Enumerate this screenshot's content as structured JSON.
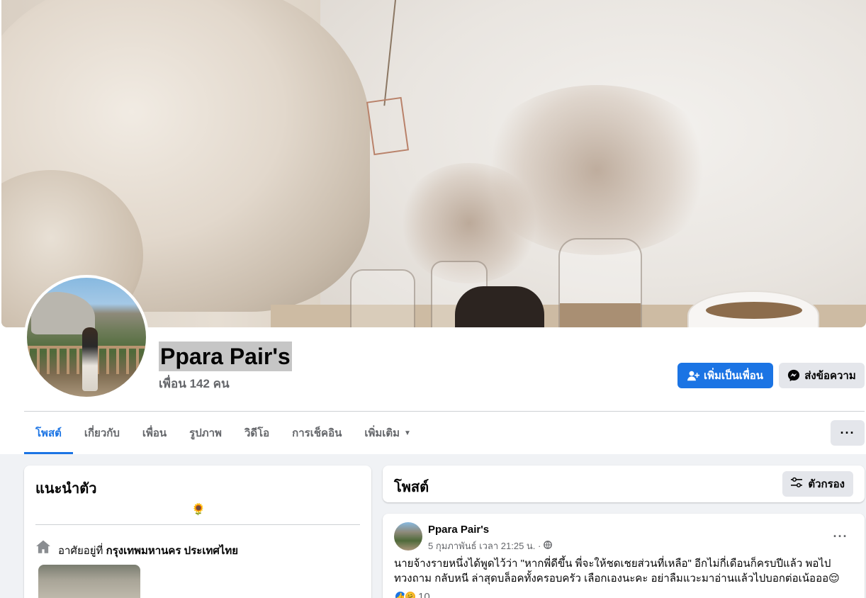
{
  "profile": {
    "name": "Ppara Pair's",
    "friends": "เพื่อน 142 คน"
  },
  "actions": {
    "add_friend": "เพิ่มเป็นเพื่อน",
    "message": "ส่งข้อความ",
    "more": "···"
  },
  "tabs": [
    {
      "label": "โพสต์",
      "active": true
    },
    {
      "label": "เกี่ยวกับ",
      "active": false
    },
    {
      "label": "เพื่อน",
      "active": false
    },
    {
      "label": "รูปภาพ",
      "active": false
    },
    {
      "label": "วิดีโอ",
      "active": false
    },
    {
      "label": "การเช็คอิน",
      "active": false
    },
    {
      "label": "เพิ่มเติม",
      "active": false
    }
  ],
  "intro": {
    "title": "แนะนำตัว",
    "bio": "🌻",
    "lives_prefix": "อาศัยอยู่ที่",
    "lives_place": "กรุงเทพมหานคร ประเทศไทย"
  },
  "posts_section": {
    "title": "โพสต์",
    "filter_label": "ตัวกรอง"
  },
  "post": {
    "author": "Ppara Pair's",
    "time": "5 กุมภาพันธ์ เวลา 21:25 น. ·",
    "text": "นายจ้างรายหนึ่งได้พูดไว้ว่า \"หากพี่ดีขึ้น พี่จะให้ชดเชยส่วนที่เหลือ\" อีกไม่กี่เดือนก็ครบปีแล้ว พอไปทวงถาม กลับหนี ล่าสุดบล็อคทั้งครอบครัว เลือกเองนะคะ อย่าลืมแวะมาอ่านแล้วไปบอกต่อเน้อออ😌",
    "reaction_count": "10",
    "more": "···"
  },
  "colors": {
    "accent": "#1b74e4",
    "secondary_text": "#65676b",
    "background": "#f0f2f5"
  }
}
